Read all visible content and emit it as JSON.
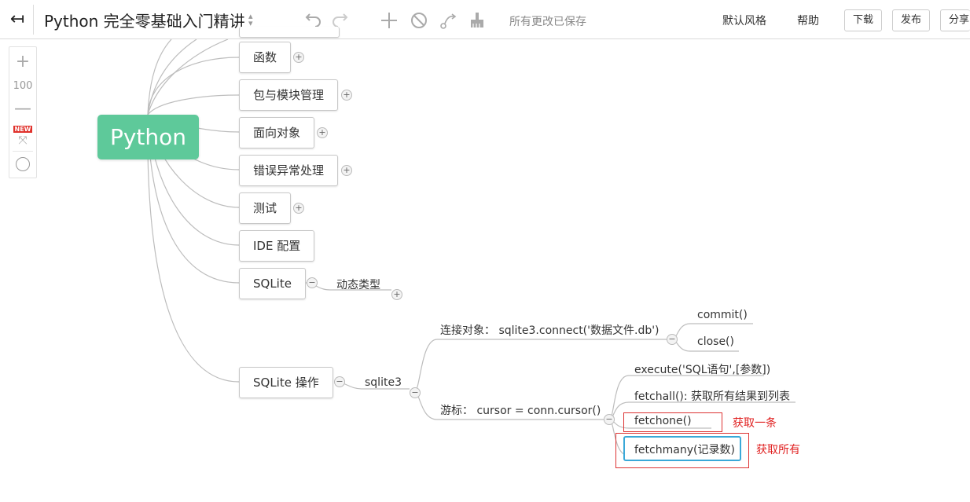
{
  "toolbar": {
    "back_icon": "back-arrow-icon",
    "title": "Python 完全零基础入门精讲",
    "save_status": "所有更改已保存",
    "theme": "默认风格",
    "help": "帮助",
    "download": "下载",
    "publish": "发布",
    "share": "分享"
  },
  "zoom": {
    "value": "100",
    "new_badge": "NEW"
  },
  "mindmap": {
    "root": "Python",
    "branches": [
      "函数",
      "包与模块管理",
      "面向对象",
      "错误异常处理",
      "测试",
      "IDE 配置",
      "SQLite",
      "SQLite 操作"
    ],
    "sqlite_child": "动态类型",
    "sqlite_op": {
      "child": "sqlite3",
      "connect": "连接对象：  sqlite3.connect('数据文件.db')",
      "connect_children": [
        "commit()",
        "close()"
      ],
      "cursor": "游标：  cursor = conn.cursor()",
      "cursor_children": [
        "execute('SQL语句',[参数])",
        "fetchall(): 获取所有结果到列表",
        "fetchone()",
        "fetchmany(记录数)"
      ]
    },
    "annotations": {
      "fetchone": "获取一条",
      "fetchmany": "获取所有"
    }
  }
}
